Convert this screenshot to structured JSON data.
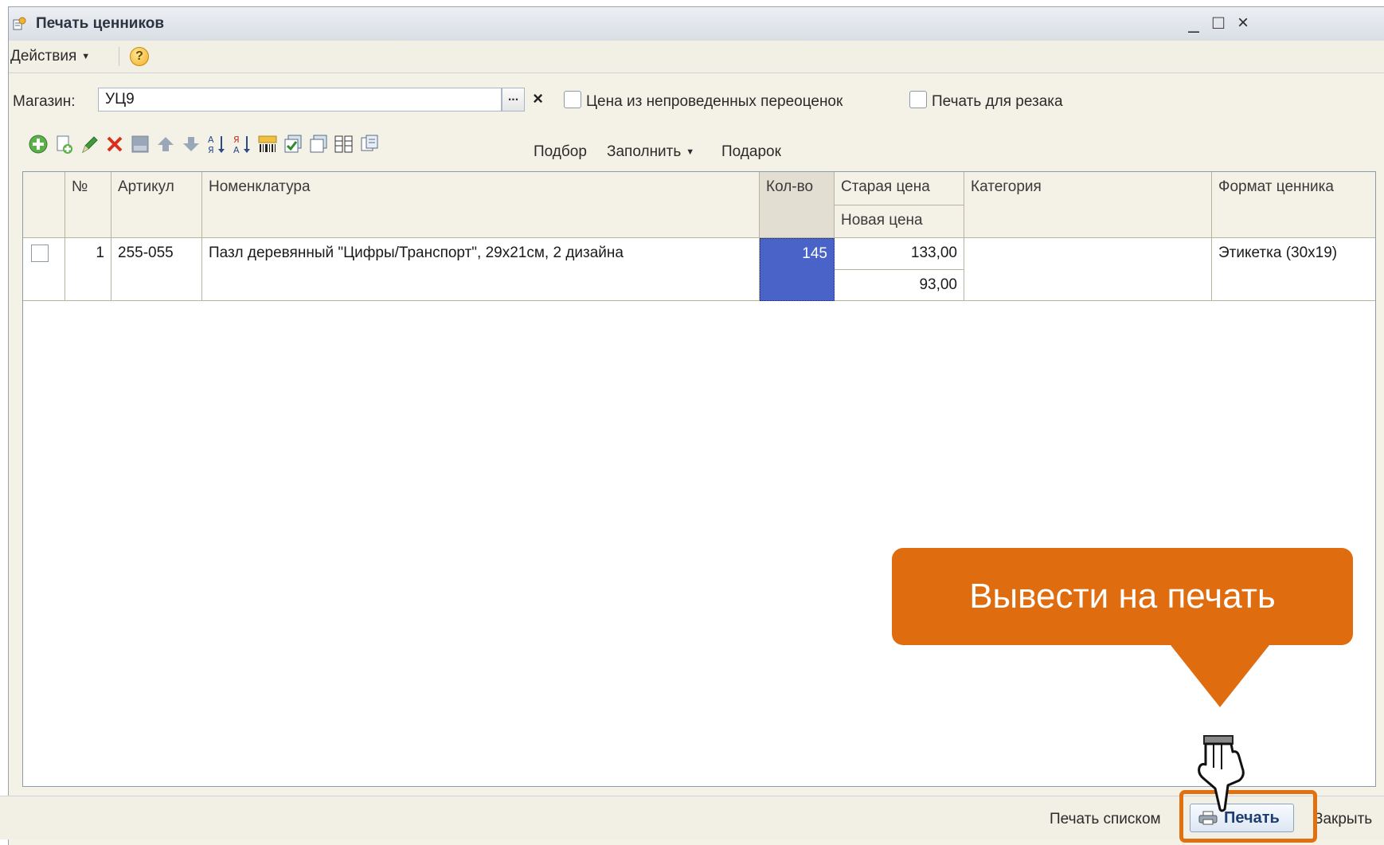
{
  "window": {
    "title": "Печать ценников",
    "controls": {
      "minimize": "_",
      "maximize": "□",
      "close": "×"
    }
  },
  "menubar": {
    "actions_label": "Действия",
    "help_icon": "?"
  },
  "form": {
    "shop_label": "Магазин:",
    "shop_value": "УЦ9",
    "shop_select_glyph": "...",
    "shop_clear_glyph": "×",
    "checkbox_unposted_label": "Цена из непроведенных переоценок",
    "checkbox_cutter_label": "Печать для резака"
  },
  "toolbar": {
    "icons": [
      "add-icon",
      "copy-icon",
      "edit-icon",
      "delete-icon",
      "post-icon",
      "move-up-icon",
      "move-down-icon",
      "sort-asc-icon",
      "sort-desc-icon",
      "barcode-icon",
      "check-all-icon",
      "uncheck-all-icon",
      "columns-icon"
    ],
    "pick_label": "Подбор",
    "fill_label": "Заполнить",
    "gift_label": "Подарок"
  },
  "table": {
    "headers": {
      "num": "№",
      "article": "Артикул",
      "nomenclature": "Номенклатура",
      "qty": "Кол-во",
      "old_price": "Старая цена",
      "new_price": "Новая цена",
      "category": "Категория",
      "tag_format": "Формат ценника"
    },
    "rows": [
      {
        "checked": false,
        "num": "1",
        "article": "255-055",
        "nomenclature": "Пазл деревянный \"Цифры/Транспорт\", 29х21см, 2 дизайна",
        "qty": "145",
        "old_price": "133,00",
        "new_price": "93,00",
        "category": "",
        "tag_format": "Этикетка (30x19)"
      }
    ]
  },
  "footer": {
    "print_list_label": "Печать списком",
    "print_label": "Печать",
    "close_label": "Закрыть"
  },
  "callout": {
    "text": "Вывести на печать"
  },
  "colors": {
    "accent": "#e06c10",
    "selection": "#4a63c9",
    "print_text": "#1e3e72"
  }
}
